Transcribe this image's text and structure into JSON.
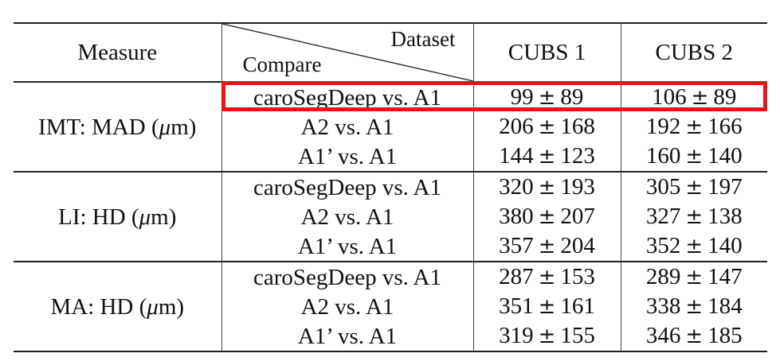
{
  "table": {
    "header": {
      "measure": "Measure",
      "dataset": "Dataset",
      "compare": "Compare",
      "cubs1": "CUBS 1",
      "cubs2": "CUBS 2"
    },
    "groups": [
      {
        "measure_prefix": "IMT: MAD (",
        "measure_unit": "μ",
        "measure_suffix": "m)",
        "rows": [
          {
            "compare": "caroSegDeep vs. A1",
            "cubs1_mean": "99",
            "cubs1_sd": "89",
            "cubs2_mean": "106",
            "cubs2_sd": "89"
          },
          {
            "compare": "A2 vs. A1",
            "cubs1_mean": "206",
            "cubs1_sd": "168",
            "cubs2_mean": "192",
            "cubs2_sd": "166"
          },
          {
            "compare": "A1’ vs. A1",
            "cubs1_mean": "144",
            "cubs1_sd": "123",
            "cubs2_mean": "160",
            "cubs2_sd": "140"
          }
        ]
      },
      {
        "measure_prefix": "LI: HD (",
        "measure_unit": "μ",
        "measure_suffix": "m)",
        "rows": [
          {
            "compare": "caroSegDeep vs. A1",
            "cubs1_mean": "320",
            "cubs1_sd": "193",
            "cubs2_mean": "305",
            "cubs2_sd": "197"
          },
          {
            "compare": "A2 vs. A1",
            "cubs1_mean": "380",
            "cubs1_sd": "207",
            "cubs2_mean": "327",
            "cubs2_sd": "138"
          },
          {
            "compare": "A1’ vs. A1",
            "cubs1_mean": "357",
            "cubs1_sd": "204",
            "cubs2_mean": "352",
            "cubs2_sd": "140"
          }
        ]
      },
      {
        "measure_prefix": "MA: HD (",
        "measure_unit": "μ",
        "measure_suffix": "m)",
        "rows": [
          {
            "compare": "caroSegDeep vs. A1",
            "cubs1_mean": "287",
            "cubs1_sd": "153",
            "cubs2_mean": "289",
            "cubs2_sd": "147"
          },
          {
            "compare": "A2 vs. A1",
            "cubs1_mean": "351",
            "cubs1_sd": "161",
            "cubs2_mean": "338",
            "cubs2_sd": "184"
          },
          {
            "compare": "A1’ vs. A1",
            "cubs1_mean": "319",
            "cubs1_sd": "155",
            "cubs2_mean": "346",
            "cubs2_sd": "185"
          }
        ]
      }
    ],
    "pm_symbol": "±",
    "highlight_color": "#e8141b"
  }
}
